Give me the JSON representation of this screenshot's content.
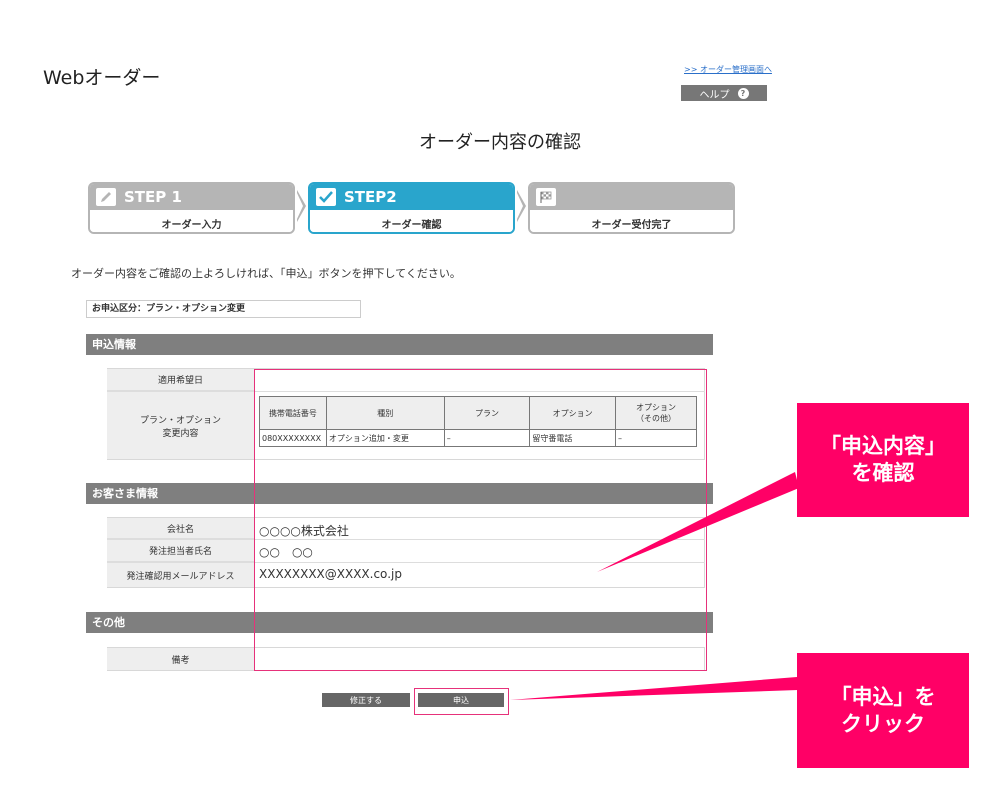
{
  "header": {
    "app_title": "Webオーダー",
    "mgmt_link": ">> オーダー管理画面へ",
    "help_label": "ヘルプ"
  },
  "page_title": "オーダー内容の確認",
  "steps": [
    {
      "label": "STEP 1",
      "sub": "オーダー入力",
      "state": "done",
      "icon": "pencil-icon"
    },
    {
      "label": "STEP2",
      "sub": "オーダー確認",
      "state": "current",
      "icon": "checkmark-icon"
    },
    {
      "label": "",
      "sub": "オーダー受付完了",
      "state": "pending",
      "icon": "checkered-flag-icon"
    }
  ],
  "instruction": "オーダー内容をご確認の上よろしければ、「申込」ボタンを押下してください。",
  "application_type": "お申込区分：プラン・オプション変更",
  "sections": {
    "application_info": {
      "title": "申込情報",
      "desired_date_label": "適用希望日",
      "desired_date_value": "",
      "plan_option_label_1": "プラン・オプション",
      "plan_option_label_2": "変更内容",
      "table_headers": [
        "携帯電話番号",
        "種別",
        "プラン",
        "オプション",
        "オプション",
        "（その他）"
      ],
      "table_row": [
        "080XXXXXXXX",
        "オプション追加・変更",
        "–",
        "留守番電話",
        "–"
      ]
    },
    "customer_info": {
      "title": "お客さま情報",
      "company_label": "会社名",
      "company_value": "○○○○株式会社",
      "person_label": "発注担当者氏名",
      "person_value": "○○　○○",
      "email_label": "発注確認用メールアドレス",
      "email_value": "XXXXXXXX@XXXX.co.jp"
    },
    "other": {
      "title": "その他",
      "notes_label": "備考",
      "notes_value": ""
    }
  },
  "buttons": {
    "modify": "修正する",
    "submit": "申込"
  },
  "callouts": {
    "review_line1": "「申込内容」",
    "review_line2": "を確認",
    "click_line1": "「申込」を",
    "click_line2": "クリック"
  },
  "colors": {
    "step_active": "#29a5cc",
    "step_inactive": "#b5b5b5",
    "section_bar": "#7f7f7f",
    "highlight": "#e6317a",
    "callout": "#ff0066"
  }
}
